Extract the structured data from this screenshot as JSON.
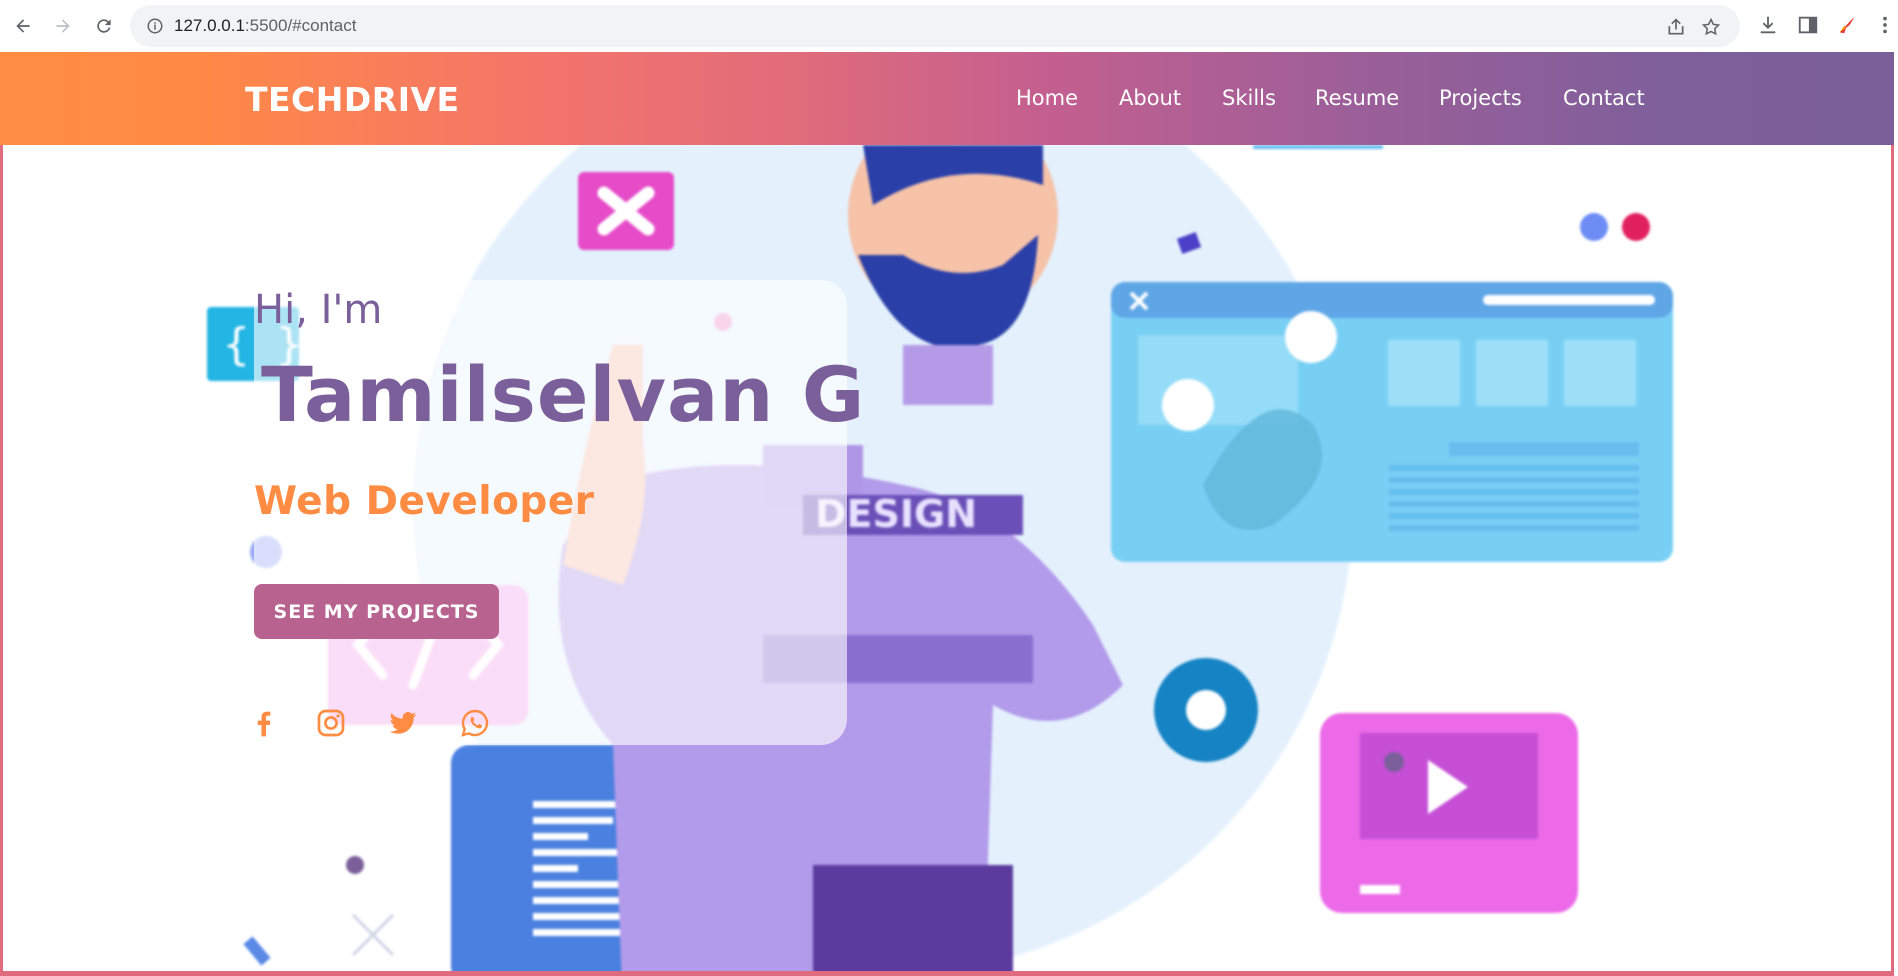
{
  "browser": {
    "url_host": "127.0.0.1",
    "url_path": ":5500/#contact",
    "icons": [
      "back-icon",
      "forward-icon",
      "reload-icon",
      "site-info-icon",
      "share-icon",
      "bookmark-star-icon",
      "download-icon",
      "side-panel-icon",
      "extension-icon",
      "more-menu-icon"
    ]
  },
  "header": {
    "logo": "TECHDRIVE",
    "nav": [
      "Home",
      "About",
      "Skills",
      "Resume",
      "Projects",
      "Contact"
    ]
  },
  "hero": {
    "greeting": "Hi, I'm",
    "name": "Tamilselvan G",
    "role": "Web Developer",
    "cta_label": "SEE MY PROJECTS",
    "social_icons": [
      "facebook-icon",
      "instagram-icon",
      "twitter-icon",
      "whatsapp-icon"
    ],
    "illustration_text": "DESIGN"
  },
  "colors": {
    "accent_orange": "#ff8c42",
    "accent_purple": "#7a5f9a",
    "button": "#b8628f",
    "header_gradient_start": "#ff8c42",
    "header_gradient_end": "#7a5f98"
  }
}
